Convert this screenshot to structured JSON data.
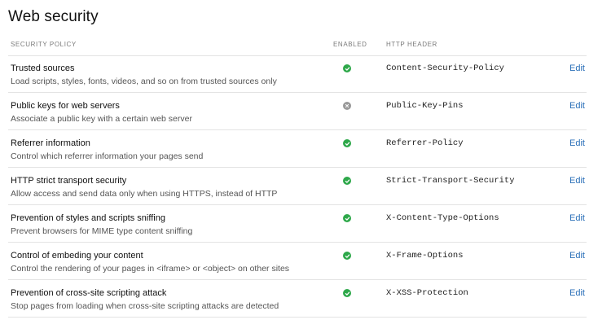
{
  "page": {
    "title": "Web security"
  },
  "table": {
    "columns": {
      "policy": "SECURITY POLICY",
      "enabled": "ENABLED",
      "header": "HTTP HEADER"
    },
    "edit_label": "Edit",
    "rows": [
      {
        "name": "Trusted sources",
        "description": "Load scripts, styles, fonts, videos, and so on from trusted sources only",
        "enabled": true,
        "header": "Content-Security-Policy"
      },
      {
        "name": "Public keys for web servers",
        "description": "Associate a public key with a certain web server",
        "enabled": false,
        "header": "Public-Key-Pins"
      },
      {
        "name": "Referrer information",
        "description": "Control which referrer information your pages send",
        "enabled": true,
        "header": "Referrer-Policy"
      },
      {
        "name": "HTTP strict transport security",
        "description": "Allow access and send data only when using HTTPS, instead of HTTP",
        "enabled": true,
        "header": "Strict-Transport-Security"
      },
      {
        "name": "Prevention of styles and scripts sniffing",
        "description": "Prevent browsers for MIME type content sniffing",
        "enabled": true,
        "header": "X-Content-Type-Options"
      },
      {
        "name": "Control of embeding your content",
        "description": "Control the rendering of your pages in <iframe> or <object> on other sites",
        "enabled": true,
        "header": "X-Frame-Options"
      },
      {
        "name": "Prevention of cross-site scripting attack",
        "description": "Stop pages from loading when cross-site scripting attacks are detected",
        "enabled": true,
        "header": "X-XSS-Protection"
      }
    ]
  },
  "colors": {
    "enabled": "#2ea84a",
    "disabled": "#9a9a9a",
    "link": "#2a6fb8"
  },
  "icons": {
    "enabled": "check-circle-icon",
    "disabled": "x-circle-icon"
  }
}
